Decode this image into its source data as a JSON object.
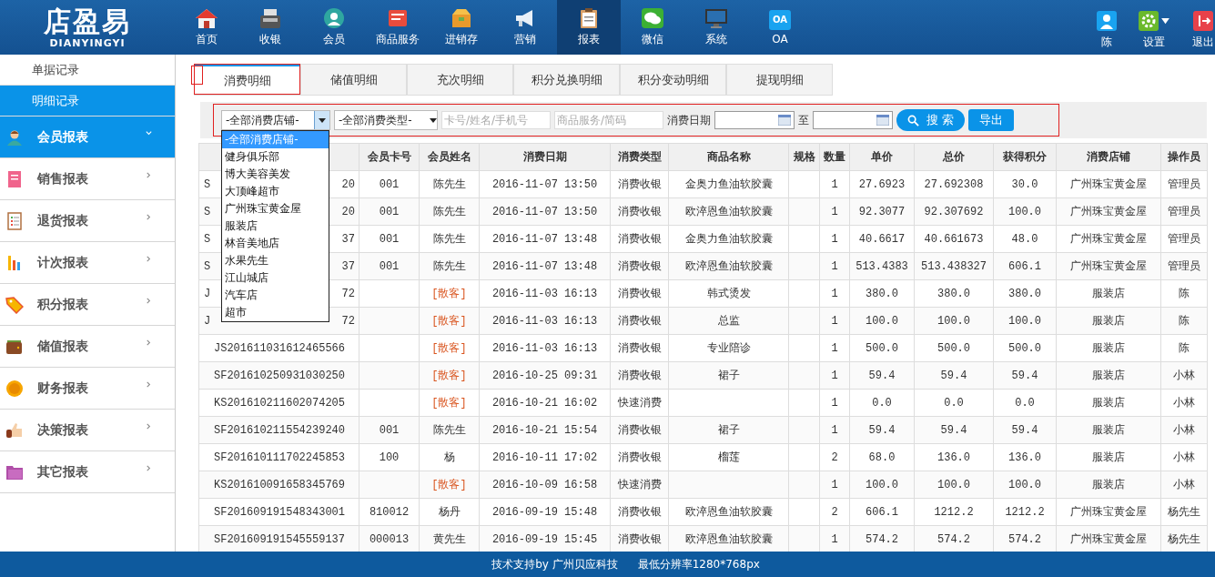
{
  "logo": {
    "title": "店盈易",
    "subtitle": "DIANYINGYI"
  },
  "nav": [
    {
      "label": "首页",
      "selected": false
    },
    {
      "label": "收银",
      "selected": false
    },
    {
      "label": "会员",
      "selected": false
    },
    {
      "label": "商品服务",
      "selected": false
    },
    {
      "label": "进销存",
      "selected": false
    },
    {
      "label": "营销",
      "selected": false
    },
    {
      "label": "报表",
      "selected": true
    },
    {
      "label": "微信",
      "selected": false
    },
    {
      "label": "系统",
      "selected": false
    },
    {
      "label": "OA",
      "selected": false,
      "icon_text": "OA"
    }
  ],
  "user_menu": [
    {
      "kind": "user",
      "label": "陈"
    },
    {
      "kind": "settings",
      "label": "设置"
    },
    {
      "kind": "logout",
      "label": "退出"
    }
  ],
  "sidebar": {
    "sub_items": [
      {
        "label": "单据记录",
        "selected": false
      },
      {
        "label": "明细记录",
        "selected": true
      }
    ],
    "groups": [
      {
        "label": "会员报表",
        "expanded": true
      },
      {
        "label": "销售报表",
        "expanded": false
      },
      {
        "label": "退货报表",
        "expanded": false
      },
      {
        "label": "计次报表",
        "expanded": false
      },
      {
        "label": "积分报表",
        "expanded": false
      },
      {
        "label": "储值报表",
        "expanded": false
      },
      {
        "label": "财务报表",
        "expanded": false
      },
      {
        "label": "决策报表",
        "expanded": false
      },
      {
        "label": "其它报表",
        "expanded": false
      }
    ]
  },
  "tabs": [
    {
      "label": "消费明细",
      "selected": true,
      "marked": true
    },
    {
      "label": "储值明细",
      "selected": false,
      "marked": false
    },
    {
      "label": "充次明细",
      "selected": false,
      "marked": false
    },
    {
      "label": "积分兑换明细",
      "selected": false,
      "marked": false
    },
    {
      "label": "积分变动明细",
      "selected": false,
      "marked": false
    },
    {
      "label": "提现明细",
      "selected": false,
      "marked": false
    }
  ],
  "filters": {
    "marked": true,
    "store_select": {
      "value": "-全部消费店铺-",
      "expanded": true,
      "options": [
        {
          "label": "-全部消费店铺-",
          "selected": true
        },
        {
          "label": "健身俱乐部",
          "selected": false
        },
        {
          "label": "博大美容美发",
          "selected": false
        },
        {
          "label": "大顶峰超市",
          "selected": false
        },
        {
          "label": "广州珠宝黄金屋",
          "selected": false
        },
        {
          "label": "服装店",
          "selected": false
        },
        {
          "label": "林音美地店",
          "selected": false
        },
        {
          "label": "水果先生",
          "selected": false
        },
        {
          "label": "江山城店",
          "selected": false
        },
        {
          "label": "汽车店",
          "selected": false
        },
        {
          "label": "超市",
          "selected": false
        }
      ]
    },
    "type_select": {
      "value": "-全部消费类型-"
    },
    "member_field": {
      "placeholder": "卡号/姓名/手机号"
    },
    "product_field": {
      "placeholder": "商品服务/简码"
    },
    "date_label": "消费日期",
    "date_to_label": "至",
    "search_button": "搜 索",
    "export_button": "导出"
  },
  "table": {
    "columns": [
      "会员卡号",
      "会员姓名",
      "消费日期",
      "消费类型",
      "商品名称",
      "规格",
      "数量",
      "单价",
      "总价",
      "获得积分",
      "消费店铺",
      "操作员"
    ],
    "rows": [
      {
        "order_no": [
          "S",
          "20"
        ],
        "guest": false,
        "cells": [
          "001",
          "陈先生",
          "2016-11-07 13:50",
          "消费收银",
          "金奥力鱼油软胶囊",
          null,
          "1",
          "27.6923",
          "27.692308",
          "30.0",
          "广州珠宝黄金屋",
          "管理员"
        ]
      },
      {
        "order_no": [
          "S",
          "20"
        ],
        "guest": false,
        "cells": [
          "001",
          "陈先生",
          "2016-11-07 13:50",
          "消费收银",
          "欧淬恩鱼油软胶囊",
          null,
          "1",
          "92.3077",
          "92.307692",
          "100.0",
          "广州珠宝黄金屋",
          "管理员"
        ]
      },
      {
        "order_no": [
          "S",
          "37"
        ],
        "guest": false,
        "cells": [
          "001",
          "陈先生",
          "2016-11-07 13:48",
          "消费收银",
          "金奥力鱼油软胶囊",
          null,
          "1",
          "40.6617",
          "40.661673",
          "48.0",
          "广州珠宝黄金屋",
          "管理员"
        ]
      },
      {
        "order_no": [
          "S",
          "37"
        ],
        "guest": false,
        "cells": [
          "001",
          "陈先生",
          "2016-11-07 13:48",
          "消费收银",
          "欧淬恩鱼油软胶囊",
          null,
          "1",
          "513.4383",
          "513.438327",
          "606.1",
          "广州珠宝黄金屋",
          "管理员"
        ]
      },
      {
        "order_no": [
          "J",
          "72"
        ],
        "guest": true,
        "cells": [
          null,
          "[散客]",
          "2016-11-03 16:13",
          "消费收银",
          "韩式烫发",
          null,
          "1",
          "380.0",
          "380.0",
          "380.0",
          "服装店",
          "陈"
        ]
      },
      {
        "order_no": [
          "J",
          "72"
        ],
        "guest": true,
        "cells": [
          null,
          "[散客]",
          "2016-11-03 16:13",
          "消费收银",
          "总监",
          null,
          "1",
          "100.0",
          "100.0",
          "100.0",
          "服装店",
          "陈"
        ]
      },
      {
        "order_no": [
          "JS201611031612465566"
        ],
        "guest": true,
        "cells": [
          null,
          "[散客]",
          "2016-11-03 16:13",
          "消费收银",
          "专业陪诊",
          null,
          "1",
          "500.0",
          "500.0",
          "500.0",
          "服装店",
          "陈"
        ]
      },
      {
        "order_no": [
          "SF201610250931030250"
        ],
        "guest": true,
        "cells": [
          null,
          "[散客]",
          "2016-10-25 09:31",
          "消费收银",
          "裙子",
          null,
          "1",
          "59.4",
          "59.4",
          "59.4",
          "服装店",
          "小林"
        ]
      },
      {
        "order_no": [
          "KS201610211602074205"
        ],
        "guest": true,
        "cells": [
          null,
          "[散客]",
          "2016-10-21 16:02",
          "快速消费",
          null,
          null,
          "1",
          "0.0",
          "0.0",
          "0.0",
          "服装店",
          "小林"
        ]
      },
      {
        "order_no": [
          "SF201610211554239240"
        ],
        "guest": false,
        "cells": [
          "001",
          "陈先生",
          "2016-10-21 15:54",
          "消费收银",
          "裙子",
          null,
          "1",
          "59.4",
          "59.4",
          "59.4",
          "服装店",
          "小林"
        ]
      },
      {
        "order_no": [
          "SF201610111702245853"
        ],
        "guest": false,
        "cells": [
          "100",
          "杨",
          "2016-10-11 17:02",
          "消费收银",
          "榴莲",
          null,
          "2",
          "68.0",
          "136.0",
          "136.0",
          "服装店",
          "小林"
        ]
      },
      {
        "order_no": [
          "KS201610091658345769"
        ],
        "guest": true,
        "cells": [
          null,
          "[散客]",
          "2016-10-09 16:58",
          "快速消费",
          null,
          null,
          "1",
          "100.0",
          "100.0",
          "100.0",
          "服装店",
          "小林"
        ]
      },
      {
        "order_no": [
          "SF201609191548343001"
        ],
        "guest": false,
        "cells": [
          "810012",
          "杨丹",
          "2016-09-19 15:48",
          "消费收银",
          "欧淬恩鱼油软胶囊",
          null,
          "2",
          "606.1",
          "1212.2",
          "1212.2",
          "广州珠宝黄金屋",
          "杨先生"
        ]
      },
      {
        "order_no": [
          "SF201609191545559137"
        ],
        "guest": false,
        "cells": [
          "000013",
          "黄先生",
          "2016-09-19 15:45",
          "消费收银",
          "欧淬恩鱼油软胶囊",
          null,
          "1",
          "574.2",
          "574.2",
          "574.2",
          "广州珠宝黄金屋",
          "杨先生"
        ]
      }
    ]
  },
  "footer": {
    "support": "技术支持by 广州贝应科技",
    "resolution": "最低分辨率1280*768px"
  }
}
